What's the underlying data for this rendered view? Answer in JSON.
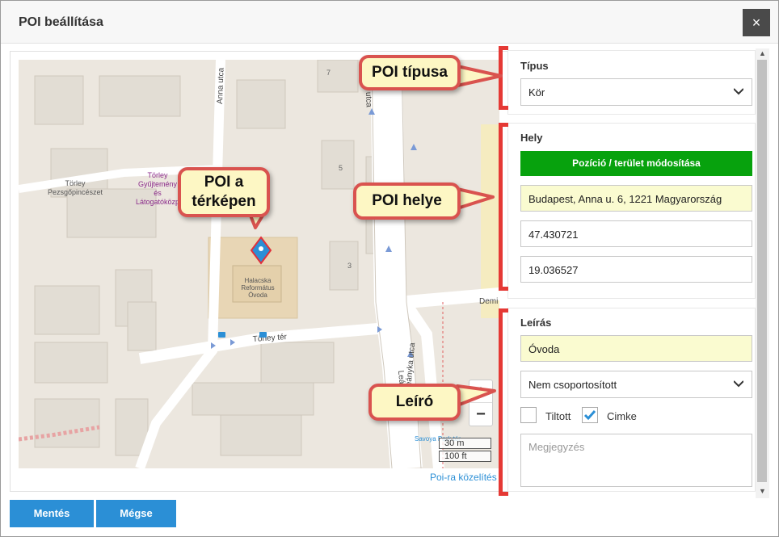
{
  "dialog": {
    "title": "POI beállítása",
    "close_label": "×"
  },
  "map": {
    "labels": {
      "anna_utca": "Anna utca",
      "torley_pezsgo": [
        "Törley",
        "Pezsgőpincészet"
      ],
      "torley_gyujtemeny": [
        "Törley",
        "Gyűjtemény",
        "és",
        "Látogatóközp"
      ],
      "ovoda": [
        "Halacska",
        "Református",
        "Óvoda"
      ],
      "torley_ter": "Törley tér",
      "leanyka_utca": "Leányka utca",
      "demi": "Demi",
      "savoya": "Savoya Park tér",
      "house_numbers": [
        "7",
        "5",
        "3"
      ],
      "le_prefix": "Leá",
      "utca_top": "utca"
    },
    "zoom_in": "+",
    "zoom_out": "−",
    "scale_m": "30 m",
    "scale_ft": "100 ft",
    "zoom_to_poi": "Poi-ra közelítés"
  },
  "tipus": {
    "label": "Típus",
    "value": "Kör"
  },
  "hely": {
    "label": "Hely",
    "modify_button": "Pozíció / terület módosítása",
    "address": "Budapest, Anna u. 6, 1221 Magyarország",
    "lat": "47.430721",
    "lon": "19.036527"
  },
  "leiras": {
    "label": "Leírás",
    "value": "Óvoda",
    "group": "Nem csoportosított",
    "tiltott_label": "Tiltott",
    "tiltott_checked": false,
    "cimke_label": "Cimke",
    "cimke_checked": true,
    "note_placeholder": "Megjegyzés"
  },
  "buttons": {
    "save": "Mentés",
    "cancel": "Mégse"
  },
  "callouts": {
    "poi_tipusa": "POI típusa",
    "poi_a_terkepen": [
      "POI a",
      "térképen"
    ],
    "poi_helye": "POI helye",
    "leiro": "Leíró"
  },
  "colors": {
    "accent_blue": "#2b8fd6",
    "green_button": "#07a20d",
    "highlight_field": "#fafbd0",
    "callout_border": "#d9534f",
    "bracket_red": "#e53935"
  }
}
